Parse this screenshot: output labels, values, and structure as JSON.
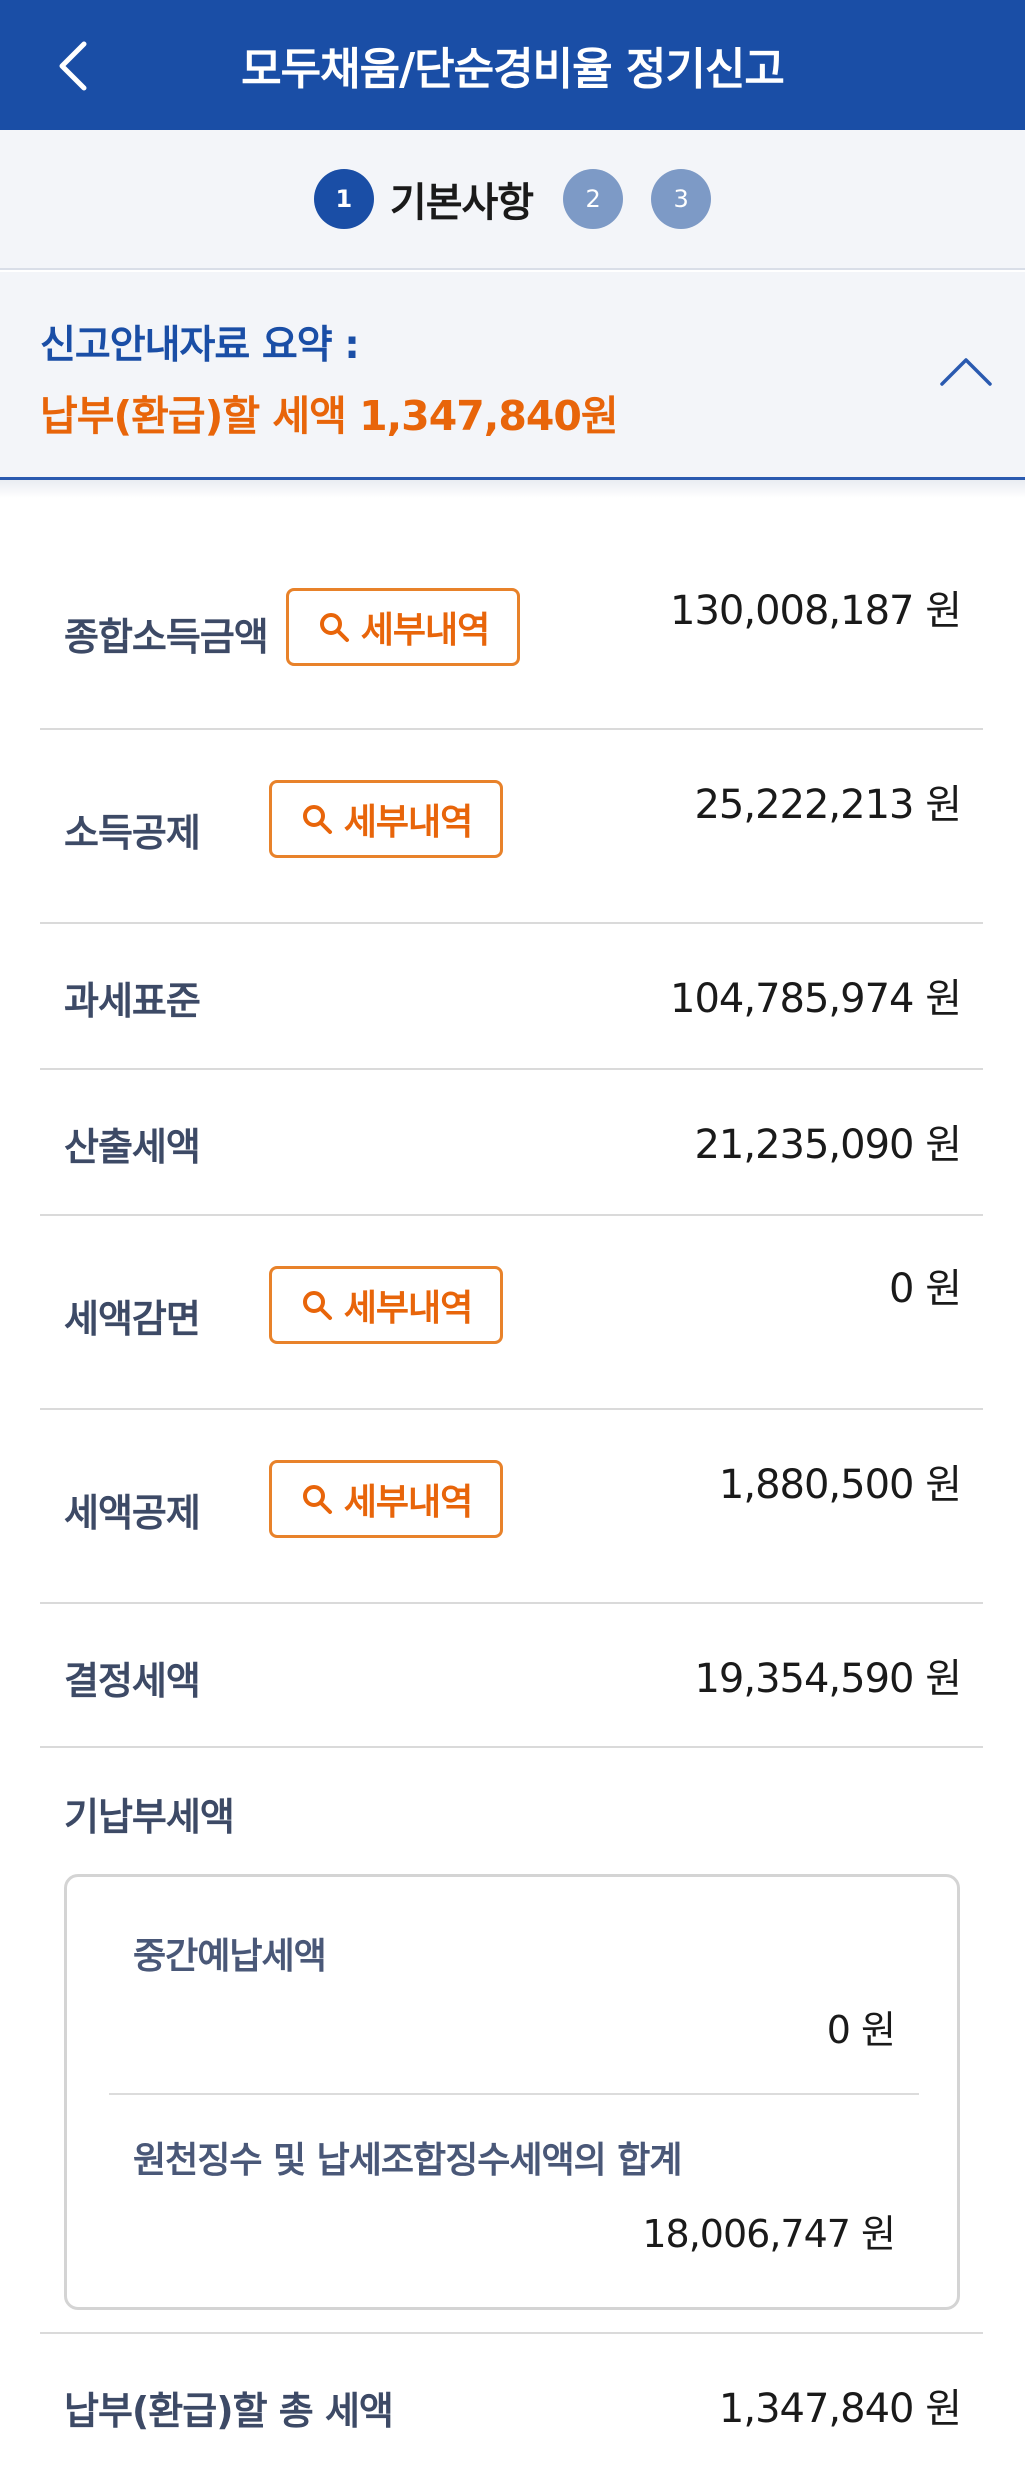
{
  "header": {
    "title": "모두채움/단순경비율 정기신고"
  },
  "stepper": {
    "steps": [
      {
        "number": "1",
        "label": "기본사항"
      },
      {
        "number": "2"
      },
      {
        "number": "3"
      }
    ],
    "active_color": "#1a4ea6",
    "inactive_color": "#7d9ac6"
  },
  "summary": {
    "title": "신고안내자료 요약 :",
    "amount_text": "납부(환급)할 세액 1,347,840원"
  },
  "detail_button_label": "세부내역",
  "rows": {
    "total_income": {
      "label": "종합소득금액",
      "value": "130,008,187  원"
    },
    "income_deduction": {
      "label": "소득공제",
      "value": "25,222,213  원"
    },
    "tax_base": {
      "label": "과세표준",
      "value": "104,785,974 원"
    },
    "calculated_tax": {
      "label": "산출세액",
      "value": "21,235,090 원"
    },
    "tax_reduction": {
      "label": "세액감면",
      "value": "0  원"
    },
    "tax_credit": {
      "label": "세액공제",
      "value": "1,880,500  원"
    },
    "determined_tax": {
      "label": "결정세액",
      "value": "19,354,590 원"
    },
    "total_payable": {
      "label": "납부(환급)할 총 세액",
      "value": "1,347,840 원"
    }
  },
  "prepaid": {
    "label": "기납부세액",
    "interim": {
      "label": "중간예납세액",
      "value": "0 원"
    },
    "withholding": {
      "label": "원천징수 및 납세조합징수세액의 합계",
      "value": "18,006,747 원"
    }
  },
  "colors": {
    "brand": "#1a4ea6",
    "accent": "#e8650a"
  }
}
